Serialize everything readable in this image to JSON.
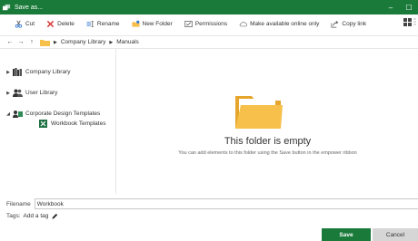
{
  "window": {
    "title": "Save as...",
    "minimize_glyph": "–",
    "maximize_glyph": "☐"
  },
  "toolbar": {
    "items": [
      {
        "label": "Cut",
        "icon": "cut-icon"
      },
      {
        "label": "Delete",
        "icon": "delete-icon"
      },
      {
        "label": "Rename",
        "icon": "rename-icon"
      },
      {
        "label": "New Folder",
        "icon": "new-folder-icon"
      },
      {
        "label": "Permissions",
        "icon": "permissions-icon"
      },
      {
        "label": "Make available online only",
        "icon": "cloud-icon"
      },
      {
        "label": "Copy link",
        "icon": "copy-link-icon"
      }
    ]
  },
  "nav": {
    "back": "←",
    "forward": "→",
    "up": "↑",
    "breadcrumbs": [
      "Company Library",
      "Manuals"
    ]
  },
  "sidebar": {
    "items": [
      {
        "label": "Company Library",
        "icon": "library-icon",
        "expanded": false
      },
      {
        "label": "User Library",
        "icon": "users-icon",
        "expanded": false
      },
      {
        "label": "Corporate Design Templates",
        "icon": "templates-icon",
        "expanded": true
      },
      {
        "label": "Workbook Templates",
        "icon": "excel-icon",
        "expanded": false
      }
    ]
  },
  "main": {
    "empty_title": "This folder is empty",
    "empty_subtitle": "You can add elements to this folder using the Save button in the empower ribbon"
  },
  "filename": {
    "label": "Filename",
    "value": "Workbook"
  },
  "tags": {
    "label": "Tags:",
    "add_label": "Add a tag"
  },
  "buttons": {
    "save": "Save",
    "cancel": "Cancel"
  },
  "colors": {
    "brand_green": "#1a7a3a",
    "folder_yellow": "#f7c04a",
    "delete_red": "#d32f2f"
  }
}
